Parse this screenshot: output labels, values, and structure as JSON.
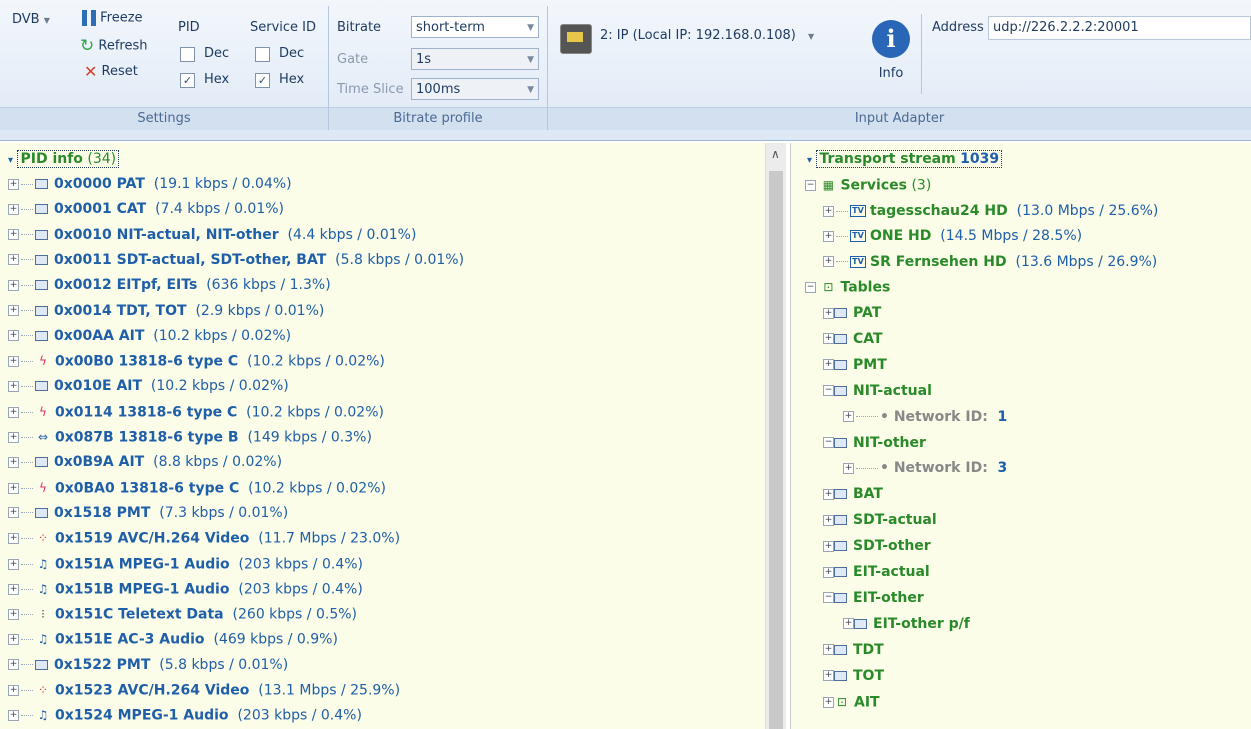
{
  "ribbon": {
    "dvb_label": "DVB",
    "freeze_label": "Freeze",
    "refresh_label": "Refresh",
    "reset_label": "Reset",
    "pid_label": "PID",
    "service_id_label": "Service ID",
    "dec_label": "Dec",
    "hex_label": "Hex",
    "settings_label": "Settings",
    "bitrate_label": "Bitrate",
    "bitrate_value": "short-term",
    "gate_label": "Gate",
    "gate_value": "1s",
    "timeslice_label": "Time Slice",
    "timeslice_value": "100ms",
    "bitrate_profile_label": "Bitrate profile",
    "adapter_value": "2: IP (Local IP: 192.168.0.108)",
    "info_label": "Info",
    "address_label": "Address",
    "address_value": "udp://226.2.2.2:20001",
    "input_adapter_label": "Input Adapter"
  },
  "left": {
    "root_label": "PID info",
    "root_count": "(34)",
    "rows": [
      {
        "pid": "0x0000",
        "name": "PAT",
        "info": "(19.1 kbps / 0.04%)",
        "icon": "table-icon"
      },
      {
        "pid": "0x0001",
        "name": "CAT",
        "info": "(7.4 kbps / 0.01%)",
        "icon": "table-icon"
      },
      {
        "pid": "0x0010",
        "name": "NIT-actual, NIT-other",
        "info": "(4.4 kbps / 0.01%)",
        "icon": "table-icon"
      },
      {
        "pid": "0x0011",
        "name": "SDT-actual, SDT-other, BAT",
        "info": "(5.8 kbps / 0.01%)",
        "icon": "table-icon"
      },
      {
        "pid": "0x0012",
        "name": "EITpf, EITs",
        "info": "(636 kbps / 1.3%)",
        "icon": "table-icon"
      },
      {
        "pid": "0x0014",
        "name": "TDT, TOT",
        "info": "(2.9 kbps / 0.01%)",
        "icon": "table-icon"
      },
      {
        "pid": "0x00AA",
        "name": "AIT",
        "info": "(10.2 kbps / 0.02%)",
        "icon": "table-icon"
      },
      {
        "pid": "0x00B0",
        "name": "13818-6 type C",
        "info": "(10.2 kbps / 0.02%)",
        "icon": "lightning-icon"
      },
      {
        "pid": "0x010E",
        "name": "AIT",
        "info": "(10.2 kbps / 0.02%)",
        "icon": "table-icon"
      },
      {
        "pid": "0x0114",
        "name": "13818-6 type C",
        "info": "(10.2 kbps / 0.02%)",
        "icon": "lightning-icon"
      },
      {
        "pid": "0x087B",
        "name": "13818-6 type B",
        "info": "(149 kbps / 0.3%)",
        "icon": "swap-icon"
      },
      {
        "pid": "0x0B9A",
        "name": "AIT",
        "info": "(8.8 kbps / 0.02%)",
        "icon": "table-icon"
      },
      {
        "pid": "0x0BA0",
        "name": "13818-6 type C",
        "info": "(10.2 kbps / 0.02%)",
        "icon": "lightning-icon"
      },
      {
        "pid": "0x1518",
        "name": "PMT",
        "info": "(7.3 kbps / 0.01%)",
        "icon": "table-icon"
      },
      {
        "pid": "0x1519",
        "name": "AVC/H.264 Video",
        "info": "(11.7 Mbps / 23.0%)",
        "icon": "video-icon"
      },
      {
        "pid": "0x151A",
        "name": "MPEG-1 Audio",
        "info": "(203 kbps / 0.4%)",
        "icon": "music-icon"
      },
      {
        "pid": "0x151B",
        "name": "MPEG-1 Audio",
        "info": "(203 kbps / 0.4%)",
        "icon": "music-icon"
      },
      {
        "pid": "0x151C",
        "name": "Teletext Data",
        "info": "(260 kbps / 0.5%)",
        "icon": "binary-icon"
      },
      {
        "pid": "0x151E",
        "name": "AC-3 Audio",
        "info": "(469 kbps / 0.9%)",
        "icon": "music-icon"
      },
      {
        "pid": "0x1522",
        "name": "PMT",
        "info": "(5.8 kbps / 0.01%)",
        "icon": "table-icon"
      },
      {
        "pid": "0x1523",
        "name": "AVC/H.264 Video",
        "info": "(13.1 Mbps / 25.9%)",
        "icon": "video-icon"
      },
      {
        "pid": "0x1524",
        "name": "MPEG-1 Audio",
        "info": "(203 kbps / 0.4%)",
        "icon": "music-icon"
      }
    ]
  },
  "right": {
    "root_label": "Transport stream",
    "root_value": "1039",
    "services_label": "Services",
    "services_count": "(3)",
    "services": [
      {
        "name": "tagesschau24 HD",
        "info": "(13.0 Mbps / 25.6%)"
      },
      {
        "name": "ONE HD",
        "info": "(14.5 Mbps / 28.5%)"
      },
      {
        "name": "SR Fernsehen HD",
        "info": "(13.6 Mbps / 26.9%)"
      }
    ],
    "tables_label": "Tables",
    "tables": [
      {
        "label": "PAT",
        "expander": "+",
        "indent": 0
      },
      {
        "label": "CAT",
        "expander": "+",
        "indent": 0
      },
      {
        "label": "PMT",
        "expander": "+",
        "indent": 0
      },
      {
        "label": "NIT-actual",
        "expander": "−",
        "indent": 0
      },
      {
        "label": "Network ID:",
        "value": "1",
        "expander": "+",
        "indent": 1,
        "grey": true
      },
      {
        "label": "NIT-other",
        "expander": "−",
        "indent": 0
      },
      {
        "label": "Network ID:",
        "value": "3",
        "expander": "+",
        "indent": 1,
        "grey": true
      },
      {
        "label": "BAT",
        "expander": "+",
        "indent": 0
      },
      {
        "label": "SDT-actual",
        "expander": "+",
        "indent": 0
      },
      {
        "label": "SDT-other",
        "expander": "+",
        "indent": 0
      },
      {
        "label": "EIT-actual",
        "expander": "+",
        "indent": 0
      },
      {
        "label": "EIT-other",
        "expander": "−",
        "indent": 0
      },
      {
        "label": "EIT-other p/f",
        "expander": "+",
        "indent": 1
      },
      {
        "label": "TDT",
        "expander": "+",
        "indent": 0
      },
      {
        "label": "TOT",
        "expander": "+",
        "indent": 0
      },
      {
        "label": "AIT",
        "expander": "+",
        "indent": 0,
        "ait": true
      }
    ]
  }
}
